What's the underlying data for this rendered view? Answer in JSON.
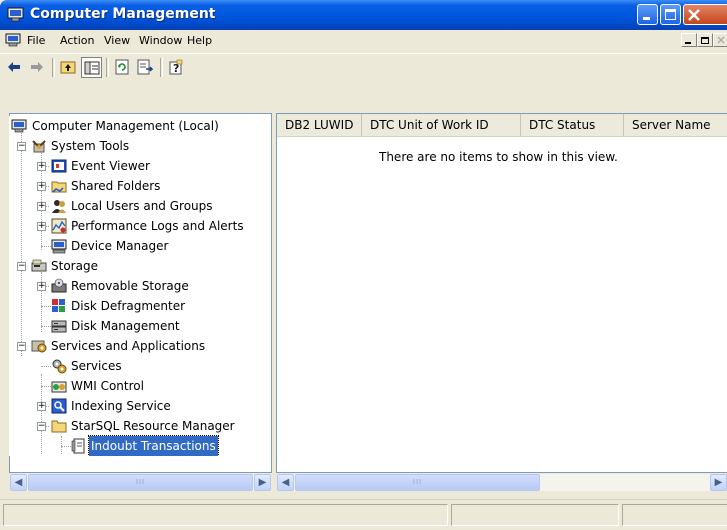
{
  "window": {
    "title": "Computer Management"
  },
  "menu": {
    "items": [
      "File",
      "Action",
      "View",
      "Window",
      "Help"
    ]
  },
  "toolbar": {
    "buttons": [
      "back-icon",
      "forward-icon",
      "up-folder-icon",
      "show-hide-console-tree-icon",
      "refresh-icon",
      "export-list-icon",
      "help-icon"
    ]
  },
  "tree": {
    "nodes": [
      {
        "label": "Computer Management (Local)",
        "icon": "computer-icon"
      },
      {
        "label": "System Tools",
        "icon": "tools-icon"
      },
      {
        "label": "Event Viewer",
        "icon": "event-viewer-icon"
      },
      {
        "label": "Shared Folders",
        "icon": "shared-folder-icon"
      },
      {
        "label": "Local Users and Groups",
        "icon": "users-icon"
      },
      {
        "label": "Performance Logs and Alerts",
        "icon": "performance-icon"
      },
      {
        "label": "Device Manager",
        "icon": "device-manager-icon"
      },
      {
        "label": "Storage",
        "icon": "storage-icon"
      },
      {
        "label": "Removable Storage",
        "icon": "removable-storage-icon"
      },
      {
        "label": "Disk Defragmenter",
        "icon": "defrag-icon"
      },
      {
        "label": "Disk Management",
        "icon": "disk-management-icon"
      },
      {
        "label": "Services and Applications",
        "icon": "services-apps-icon"
      },
      {
        "label": "Services",
        "icon": "services-icon"
      },
      {
        "label": "WMI Control",
        "icon": "wmi-icon"
      },
      {
        "label": "Indexing Service",
        "icon": "indexing-icon"
      },
      {
        "label": "StarSQL Resource Manager",
        "icon": "folder-icon"
      },
      {
        "label": "Indoubt Transactions",
        "icon": "document-icon"
      }
    ]
  },
  "list": {
    "columns": [
      "DB2 LUWID",
      "DTC Unit of Work ID",
      "DTC Status",
      "Server Name"
    ],
    "empty_message": "There are no items to show in this view."
  },
  "scrollbar": {
    "thumb_grip": "III"
  }
}
